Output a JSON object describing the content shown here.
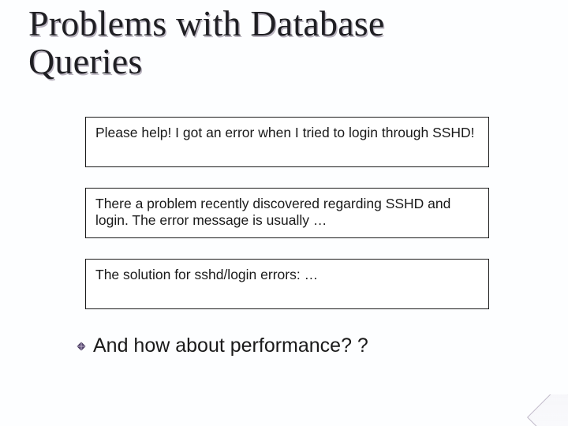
{
  "title": "Problems with Database\nQueries",
  "boxes": [
    {
      "text": "Please help! I got an error when I tried to login through SSHD!"
    },
    {
      "text": "There a problem recently discovered regarding SSHD and login. The error message is usually …"
    },
    {
      "text": "The solution for sshd/login errors: …"
    }
  ],
  "bullet": "And how about performance? ?"
}
